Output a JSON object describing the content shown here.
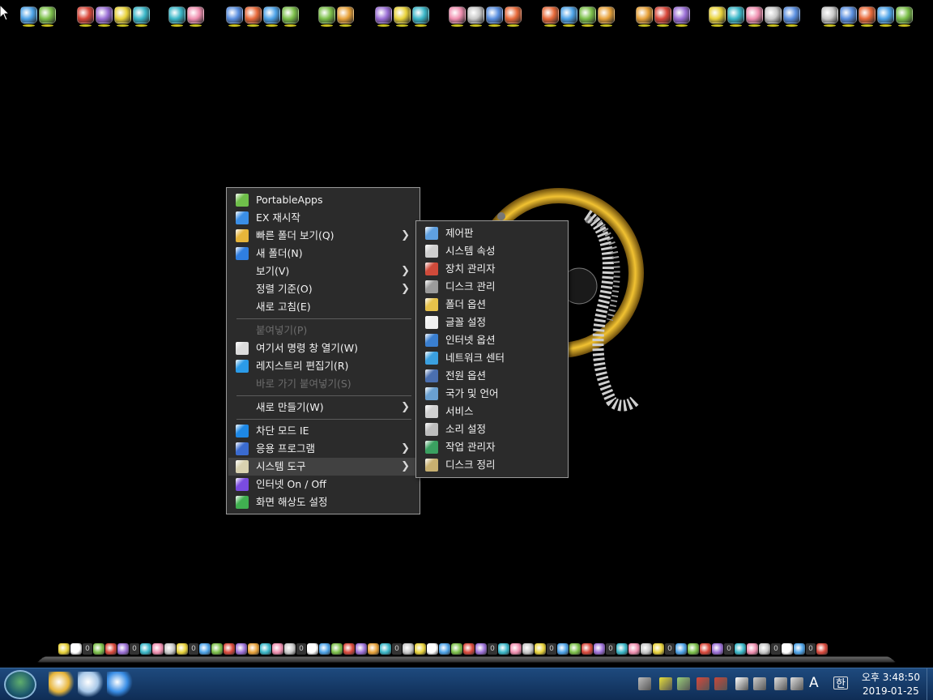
{
  "colors": {
    "menu_bg": "#2b2b2b",
    "menu_highlight": "#414141",
    "menu_disabled": "#6d6d6d",
    "taskbar": "#173c69"
  },
  "top_bar": {
    "groups": [
      {
        "icons": [
          "paint-drop-icon",
          "paint-drop-icon"
        ]
      },
      {
        "icons": [
          "laptop-icon",
          "monitor-icon",
          "tools-icon",
          "trash-icon"
        ]
      },
      {
        "icons": [
          "dice-icon",
          "dice-icon"
        ]
      },
      {
        "icons": [
          "drive-icon",
          "window-icon",
          "folder-star-icon",
          "windows-icon"
        ]
      },
      {
        "icons": [
          "disk-icon",
          "pen-icon"
        ]
      },
      {
        "icons": [
          "cursor-box-icon",
          "font-a-icon",
          "fc-icon"
        ]
      },
      {
        "icons": [
          "satellite-icon",
          "tools-icon",
          "scanner-icon",
          "drive-icon"
        ]
      },
      {
        "icons": [
          "bluetooth-icon",
          "7z-icon",
          "cd-icon",
          "usb-icon"
        ]
      },
      {
        "icons": [
          "64bit-icon",
          "chip-icon",
          "lightning-icon"
        ]
      },
      {
        "icons": [
          "user-icon",
          "network-icon",
          "help-icon",
          "puzzle-icon",
          "lock-icon"
        ]
      },
      {
        "icons": [
          "search-icon",
          "globe-icon",
          "floppy-icon",
          "window-icon",
          "power-icon"
        ]
      }
    ]
  },
  "main_menu": {
    "items": [
      {
        "label": "PortableApps",
        "icon": "portableapps-icon",
        "color": "#6fbf4a"
      },
      {
        "label": "EX 재시작",
        "icon": "refresh-icon",
        "color": "#3a8ee6"
      },
      {
        "label": "빠른 폴더 보기(Q)",
        "icon": "folder-icon",
        "color": "#e7b53a",
        "arrow": "❯"
      },
      {
        "label": "새 폴더(N)",
        "icon": "compass-icon",
        "color": "#2f7ee0"
      },
      {
        "label": "보기(V)",
        "arrow": "❯"
      },
      {
        "label": "정렬 기준(O)",
        "arrow": "❯"
      },
      {
        "label": "새로 고침(E)"
      },
      {
        "sep": true
      },
      {
        "label": "붙여넣기(P)",
        "disabled": true
      },
      {
        "label": "여기서 명령 창 열기(W)",
        "icon": "cmd-icon",
        "color": "#dcdcdc"
      },
      {
        "label": "레지스트리 편집기(R)",
        "icon": "registry-icon",
        "color": "#2b9be8"
      },
      {
        "label": "바로 가기 붙여넣기(S)",
        "disabled": true
      },
      {
        "sep": true
      },
      {
        "label": "새로 만들기(W)",
        "arrow": "❯"
      },
      {
        "sep": true
      },
      {
        "label": "차단 모드 IE",
        "icon": "ie-icon",
        "color": "#1e88e5"
      },
      {
        "label": "응용 프로그램",
        "icon": "apps-icon",
        "color": "#3a6bd0",
        "arrow": "❯"
      },
      {
        "label": "시스템 도구",
        "icon": "system-tools-icon",
        "color": "#d9d2b0",
        "arrow": "❯",
        "highlight": true
      },
      {
        "label": "인터넷 On / Off",
        "icon": "network-toggle-icon",
        "color": "#7a4be0"
      },
      {
        "label": "화면 해상도 설정",
        "icon": "display-icon",
        "color": "#40b050"
      }
    ]
  },
  "sub_menu": {
    "items": [
      {
        "label": "제어판",
        "icon": "control-panel-icon",
        "color": "#5fa0e0"
      },
      {
        "label": "시스템 속성",
        "icon": "system-properties-icon",
        "color": "#cfcfcf"
      },
      {
        "label": "장치 관리자",
        "icon": "device-manager-icon",
        "color": "#d04a3a"
      },
      {
        "label": "디스크 관리",
        "icon": "disk-management-icon",
        "color": "#9a9a9a"
      },
      {
        "label": "폴더 옵션",
        "icon": "folder-options-icon",
        "color": "#e7c24a"
      },
      {
        "label": "글꼴 설정",
        "icon": "font-icon",
        "color": "#f0f0f0"
      },
      {
        "label": "인터넷 옵션",
        "icon": "internet-options-icon",
        "color": "#3a7fd0"
      },
      {
        "label": "네트워크 센터",
        "icon": "network-center-icon",
        "color": "#3aa0e0"
      },
      {
        "label": "전원 옵션",
        "icon": "power-options-icon",
        "color": "#4a6fb0"
      },
      {
        "label": "국가 및 언어",
        "icon": "region-icon",
        "color": "#6aa0d0"
      },
      {
        "label": "서비스",
        "icon": "services-icon",
        "color": "#d0d0d0"
      },
      {
        "label": "소리 설정",
        "icon": "sound-icon",
        "color": "#bdbdbd"
      },
      {
        "label": "작업 관리자",
        "icon": "task-manager-icon",
        "color": "#3aa060"
      },
      {
        "label": "디스크 정리",
        "icon": "disk-cleanup-icon",
        "color": "#c8b070"
      }
    ]
  },
  "dock": {
    "count_label": "0",
    "icons": [
      "pen-icon",
      "power-icon",
      "count",
      "help-icon",
      "color-icon",
      "windows-icon",
      "count",
      "tools-icon",
      "map-icon",
      "clock-icon",
      "fan-icon",
      "count",
      "play-icon",
      "bird-icon",
      "fox-icon",
      "chrome-icon",
      "edge-icon",
      "m-icon",
      "chrome-icon",
      "gear-icon",
      "count",
      "word-icon",
      "excel-icon",
      "ppt-icon",
      "pdf-icon",
      "hwp-icon",
      "hancom-icon",
      "music-icon",
      "count",
      "play-icon",
      "warning-icon",
      "headphone-icon",
      "a-icon",
      "tools-icon",
      "video-icon",
      "gear-icon",
      "count",
      "torrent-icon",
      "chat-icon",
      "kakao-icon",
      "p-icon",
      "count",
      "grid-icon",
      "record-icon",
      "pen-icon",
      "code-icon",
      "count",
      "film-icon",
      "ban-icon",
      "camera-icon",
      "cd-icon",
      "count",
      "network-icon",
      "display-icon",
      "volume-icon",
      "laptop-icon",
      "count",
      "v-icon",
      "x-icon",
      "check-icon",
      "count",
      "cmd-icon",
      "chart-icon",
      "count",
      "power-icon"
    ]
  },
  "taskbar": {
    "apps": [
      "explorer-icon",
      "remote-desktop-icon",
      "ie-icon"
    ],
    "tray": [
      "network-icon",
      "toy-icon",
      "usb-icon",
      "shield-icon",
      "flag-icon",
      "ime-icon",
      "tools-icon",
      "safely-remove-icon",
      "volume-icon"
    ],
    "ime_mode": "A",
    "ime_lang": "한",
    "time": "오후 3:48:50",
    "date": "2019-01-25"
  }
}
